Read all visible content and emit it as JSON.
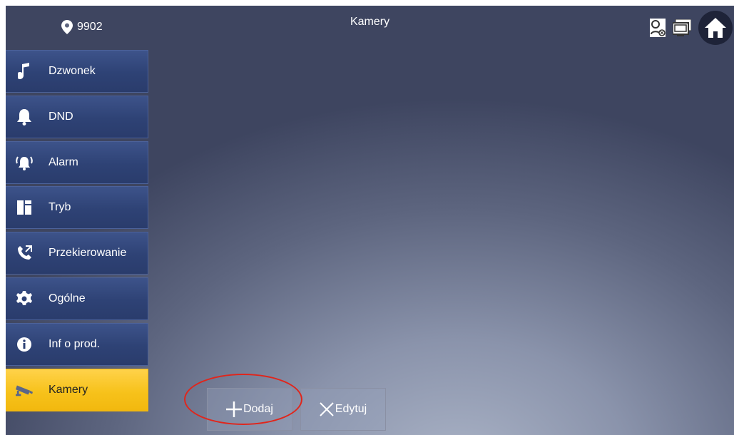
{
  "header": {
    "location": "9902",
    "title": "Kamery"
  },
  "top_icons": [
    "contacts-icon",
    "monitor-icon",
    "home-icon"
  ],
  "sidebar": {
    "items": [
      {
        "label": "Dzwonek",
        "icon": "music-note-icon"
      },
      {
        "label": "DND",
        "icon": "bell-icon"
      },
      {
        "label": "Alarm",
        "icon": "alarm-bell-icon"
      },
      {
        "label": "Tryb",
        "icon": "mode-grid-icon"
      },
      {
        "label": "Przekierowanie",
        "icon": "call-forward-icon"
      },
      {
        "label": "Ogólne",
        "icon": "gear-icon"
      },
      {
        "label": "Inf o prod.",
        "icon": "info-icon"
      },
      {
        "label": "Kamery",
        "icon": "camera-icon",
        "active": true
      }
    ]
  },
  "actions": {
    "add_label": "Dodaj",
    "edit_label": "Edytuj"
  },
  "colors": {
    "sidebar_bg": "#2e4275",
    "active_bg": "#f7c21b",
    "highlight": "#e1251b"
  }
}
